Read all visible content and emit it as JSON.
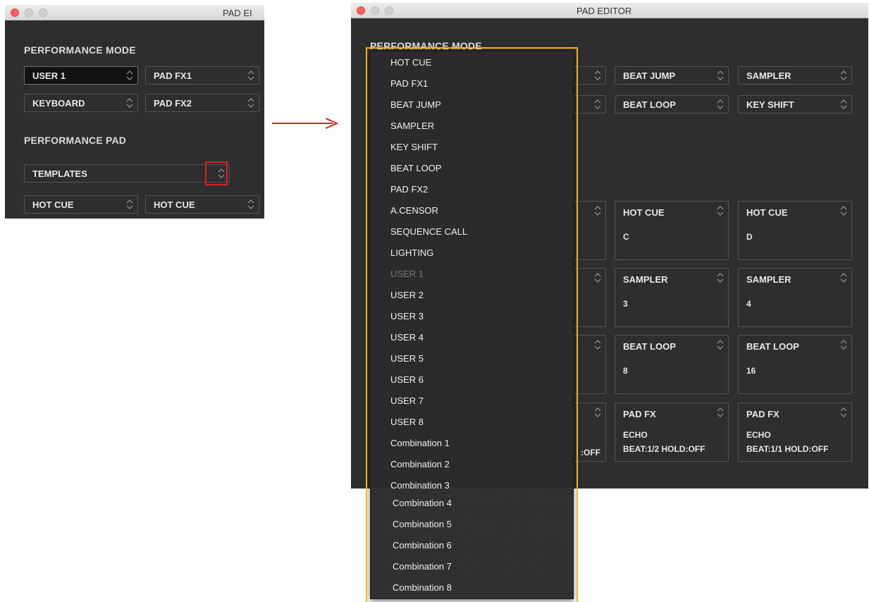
{
  "left_window": {
    "title": "PAD EI",
    "performance_mode_label": "PERFORMANCE MODE",
    "mode_selects": [
      "USER 1",
      "PAD FX1",
      "KEYBOARD",
      "PAD FX2"
    ],
    "performance_pad_label": "PERFORMANCE PAD",
    "templates_label": "TEMPLATES",
    "pad_selects": [
      "HOT CUE",
      "HOT CUE"
    ]
  },
  "right_window": {
    "title": "PAD EDITOR",
    "performance_mode_label": "PERFORMANCE MODE",
    "mode_selects": [
      "BEAT JUMP",
      "SAMPLER",
      "BEAT LOOP",
      "KEY SHIFT"
    ],
    "pads": [
      {
        "label": "HOT CUE",
        "sub": "C",
        "sub2": ""
      },
      {
        "label": "HOT CUE",
        "sub": "D",
        "sub2": ""
      },
      {
        "label": "SAMPLER",
        "sub": "3",
        "sub2": ""
      },
      {
        "label": "SAMPLER",
        "sub": "4",
        "sub2": ""
      },
      {
        "label": "BEAT LOOP",
        "sub": "8",
        "sub2": ""
      },
      {
        "label": "BEAT LOOP",
        "sub": "16",
        "sub2": ""
      },
      {
        "label": "PAD FX",
        "sub": "ECHO",
        "sub2": "BEAT:1/2 HOLD:OFF"
      },
      {
        "label": "PAD FX",
        "sub": "ECHO",
        "sub2": "BEAT:1/1 HOLD:OFF"
      }
    ],
    "partial_text": ":OFF"
  },
  "dropdown": {
    "items": [
      "HOT CUE",
      "PAD FX1",
      "BEAT JUMP",
      "SAMPLER",
      "KEY SHIFT",
      "BEAT LOOP",
      "PAD FX2",
      "A.CENSOR",
      "SEQUENCE CALL",
      "LIGHTING",
      "USER 1",
      "USER 2",
      "USER 3",
      "USER 4",
      "USER 5",
      "USER 6",
      "USER 7",
      "USER 8",
      "Combination 1",
      "Combination 2",
      "Combination 3",
      "Combination 4",
      "Combination 5",
      "Combination 6",
      "Combination 7",
      "Combination 8"
    ],
    "disabled_item": "USER 1"
  },
  "colors": {
    "panel_bg": "#2e2e2e",
    "highlight_red": "#e02020",
    "highlight_gold": "#f2b51c"
  },
  "icons": {
    "stepper": "chevron-up-down-icon",
    "arrow": "arrow-right-icon"
  }
}
